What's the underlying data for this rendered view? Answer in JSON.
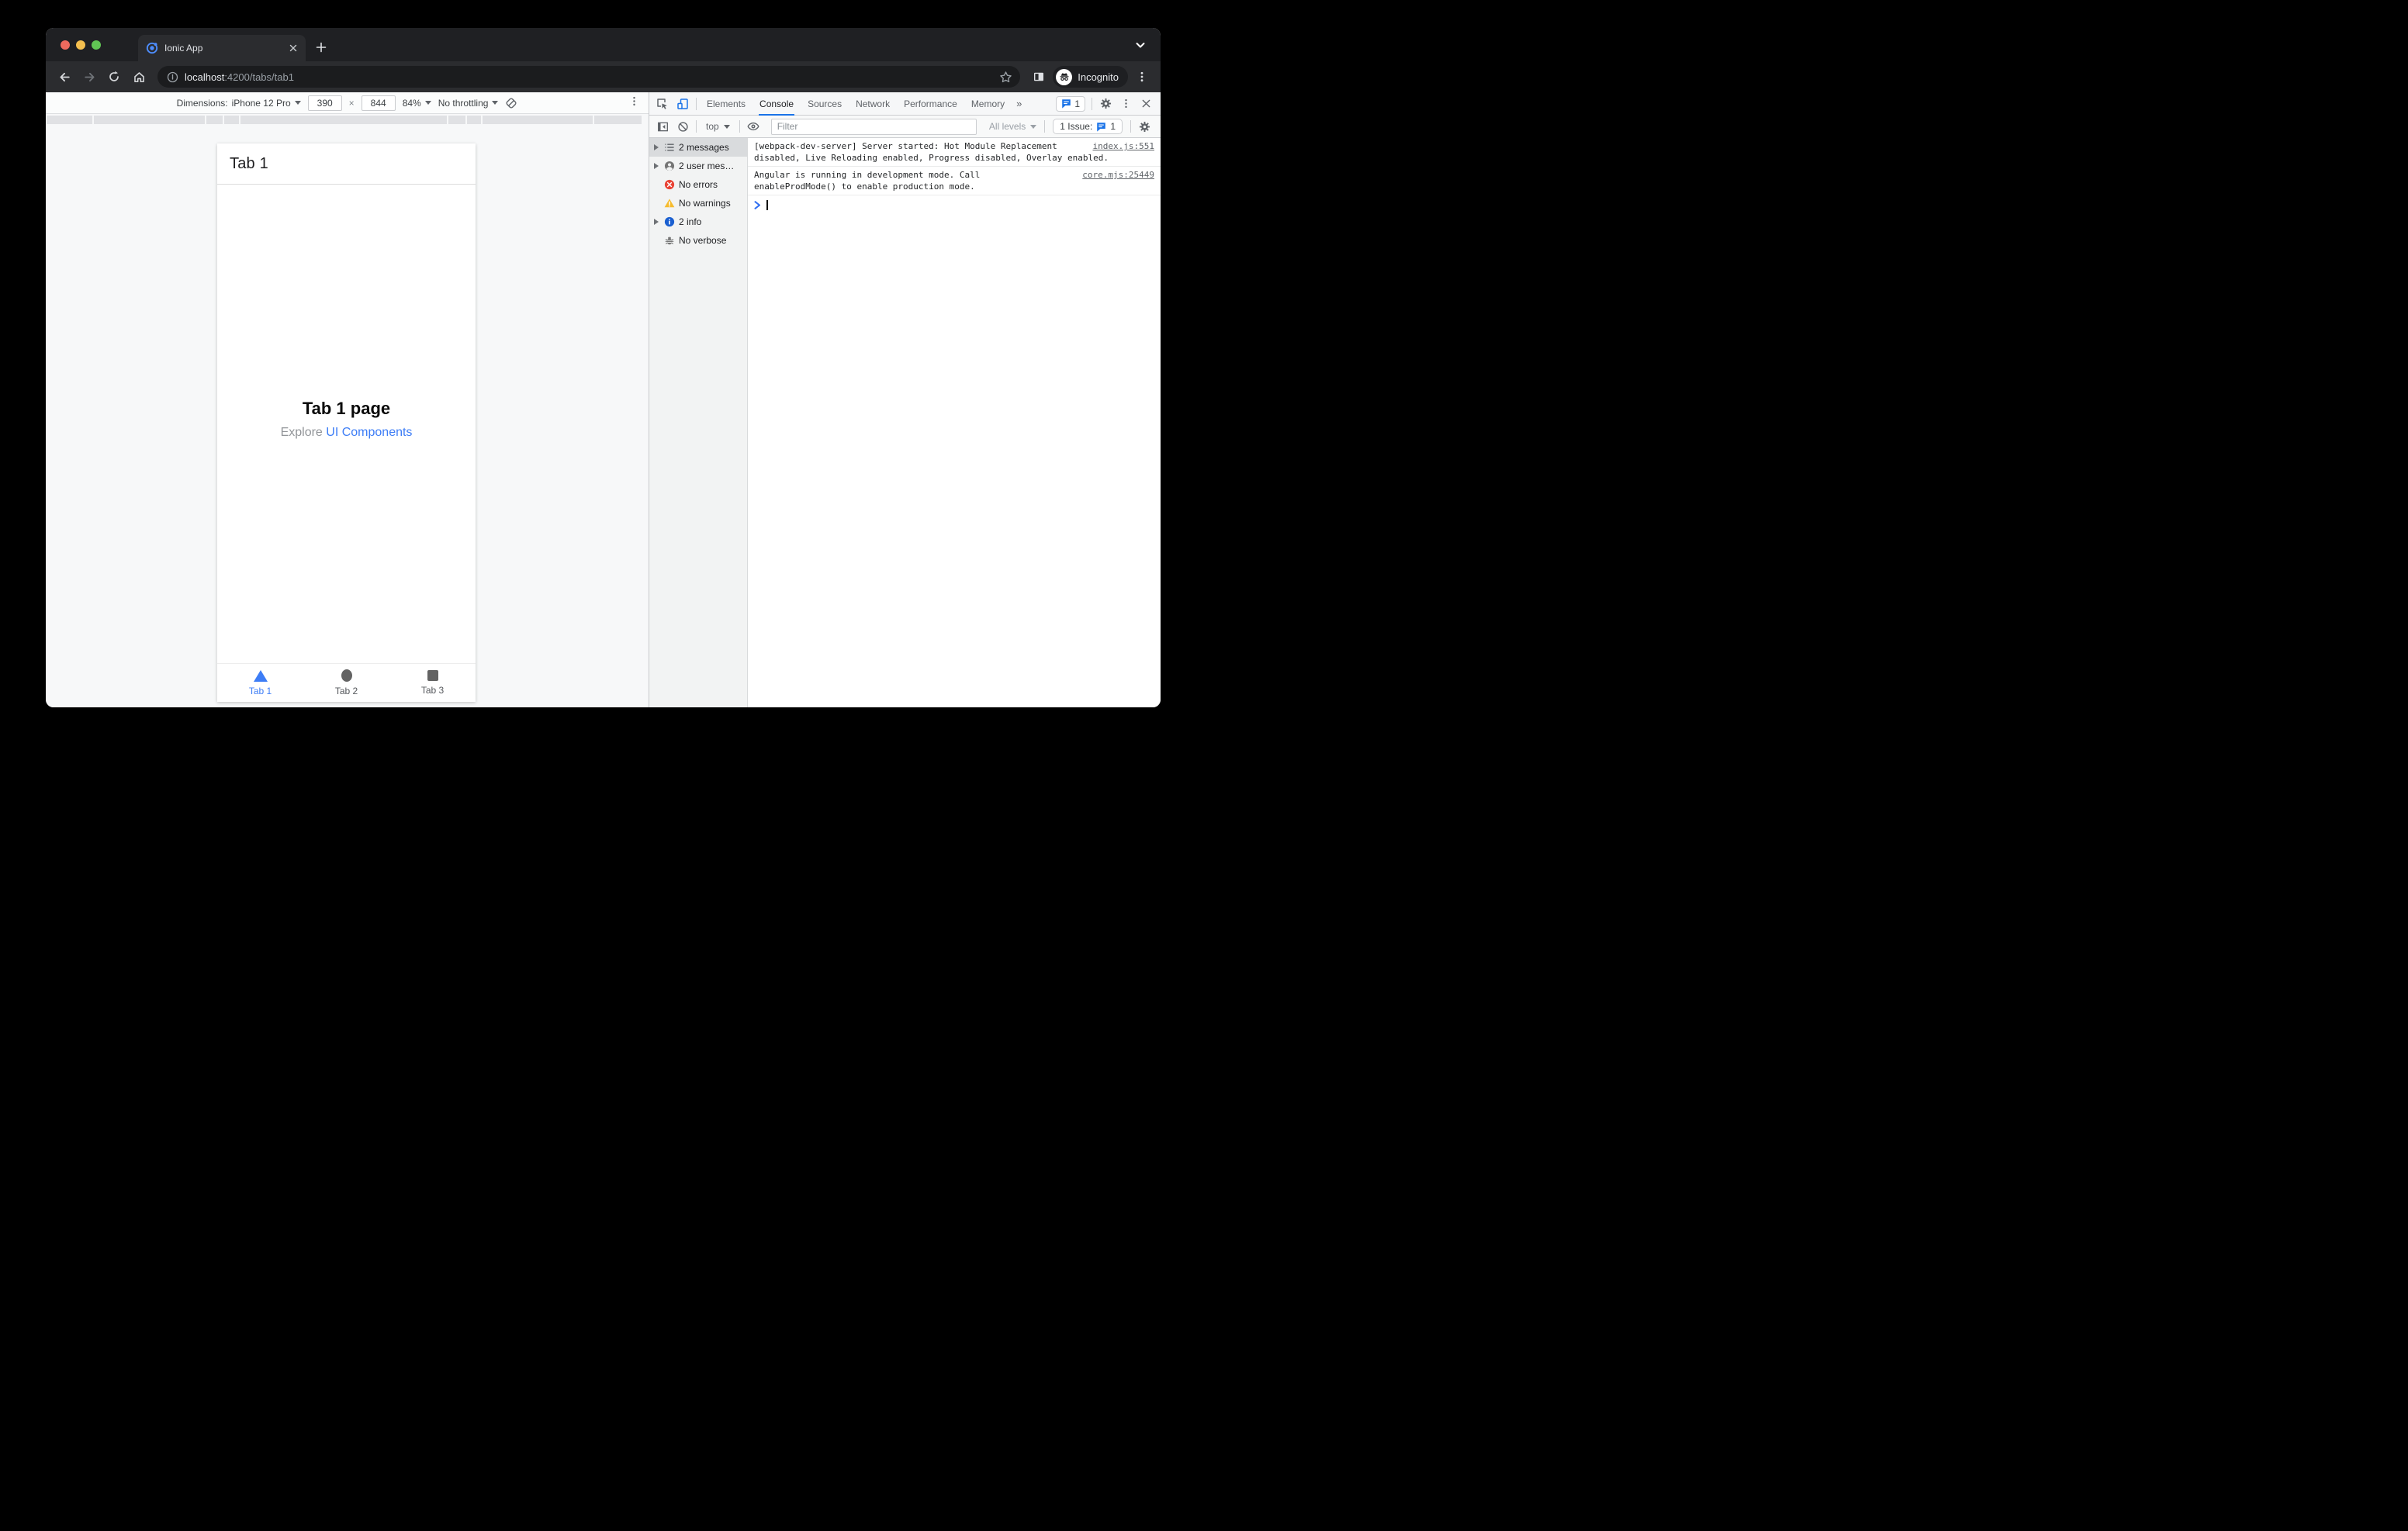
{
  "browser": {
    "tab_title": "Ionic App",
    "url": {
      "host": "localhost",
      "rest": ":4200/tabs/tab1"
    },
    "incognito_label": "Incognito"
  },
  "device_toolbar": {
    "dimensions_label": "Dimensions:",
    "device_name": "iPhone 12 Pro",
    "width_value": "390",
    "separator": "×",
    "height_value": "844",
    "zoom_value": "84%",
    "throttling_value": "No throttling"
  },
  "app": {
    "header_title": "Tab 1",
    "page_title": "Tab 1 page",
    "explore_prefix": "Explore ",
    "explore_link": "UI Components",
    "tab_bar": [
      {
        "label": "Tab 1",
        "icon": "triangle-icon",
        "active": true
      },
      {
        "label": "Tab 2",
        "icon": "ellipse-icon",
        "active": false
      },
      {
        "label": "Tab 3",
        "icon": "square-icon",
        "active": false
      }
    ]
  },
  "devtools": {
    "panel_tabs": [
      {
        "label": "Elements",
        "active": false
      },
      {
        "label": "Console",
        "active": true
      },
      {
        "label": "Sources",
        "active": false
      },
      {
        "label": "Network",
        "active": false
      },
      {
        "label": "Performance",
        "active": false
      },
      {
        "label": "Memory",
        "active": false
      }
    ],
    "more_tabs_symbol": "»",
    "tabbar_issue_count": "1",
    "console_toolbar": {
      "context_value": "top",
      "filter_placeholder": "Filter",
      "levels_value": "All levels",
      "issues_label": "1 Issue:",
      "issues_count": "1"
    },
    "sidebar_items": [
      {
        "label": "2 messages",
        "icon": "list-icon",
        "selected": true,
        "expandable": true
      },
      {
        "label": "2 user mes…",
        "icon": "user-icon",
        "selected": false,
        "expandable": true
      },
      {
        "label": "No errors",
        "icon": "error-icon",
        "selected": false,
        "expandable": false
      },
      {
        "label": "No warnings",
        "icon": "warning-icon",
        "selected": false,
        "expandable": false
      },
      {
        "label": "2 info",
        "icon": "info-icon",
        "selected": false,
        "expandable": true
      },
      {
        "label": "No verbose",
        "icon": "verbose-bug-icon",
        "selected": false,
        "expandable": false
      }
    ],
    "messages": [
      {
        "text": "[webpack-dev-server] Server started: Hot Module Replacement\ndisabled, Live Reloading enabled, Progress disabled, Overlay enabled.",
        "source": "index.js:551",
        "level": "info"
      },
      {
        "text": "Angular is running in development mode. Call\nenableProdMode() to enable production mode.",
        "source": "core.mjs:25449",
        "level": "info"
      }
    ]
  },
  "colors": {
    "devtools_accent": "#1a73e8",
    "ionic_primary": "#3d7df6",
    "error_red": "#e94335",
    "warning_yellow": "#f6bb2e",
    "info_blue": "#1a5fd0",
    "chrome_dark_frame": "#1f2023",
    "chrome_dark_toolbar": "#2b2c2f"
  }
}
